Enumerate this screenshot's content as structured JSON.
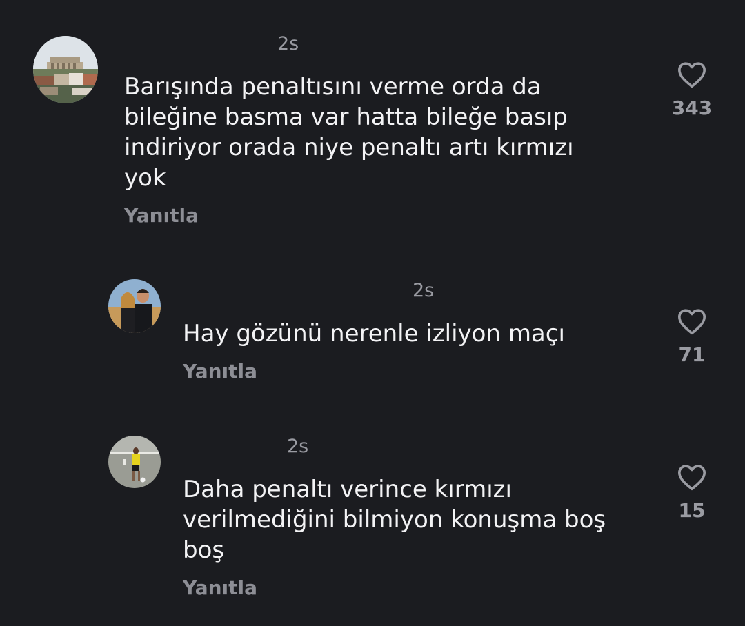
{
  "comments": [
    {
      "time": "2s",
      "text": "Barışında penaltısını verme orda da\nbileğine basma var hatta bileğe basıp\nindiriyor orada niye penaltı artı kırmızı\nyok",
      "reply_label": "Yanıtla",
      "likes": "343",
      "like_icon": "heart-outline-icon",
      "avatar": "building-photo-avatar"
    },
    {
      "time": "2s",
      "text": "Hay gözünü nerenle izliyon maçı",
      "reply_label": "Yanıtla",
      "likes": "71",
      "like_icon": "heart-outline-icon",
      "avatar": "couple-photo-avatar"
    },
    {
      "time": "2s",
      "text": "Daha penaltı verince kırmızı\nverilmediğini bilmiyon konuşma boş\nboş",
      "reply_label": "Yanıtla",
      "likes": "15",
      "like_icon": "heart-outline-icon",
      "avatar": "football-player-avatar"
    }
  ],
  "colors": {
    "background": "#1b1c20",
    "text": "#f3f3f5",
    "muted": "#9a9ba2"
  }
}
